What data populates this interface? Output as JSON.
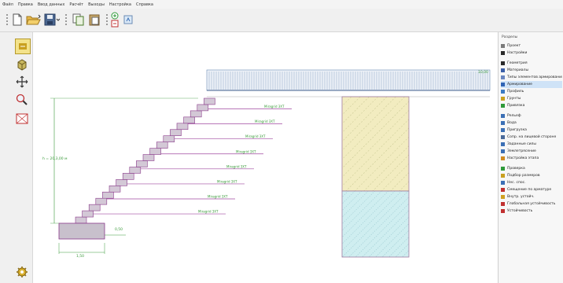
{
  "menu": [
    "Файл",
    "Правка",
    "Ввод данных",
    "Расчёт",
    "Выходы",
    "Настройка",
    "Справка"
  ],
  "panel": {
    "title": "Разделы",
    "items": [
      {
        "label": "Проект",
        "color": "#7a7a7a",
        "gap": false,
        "selected": false
      },
      {
        "label": "Настройки",
        "color": "#2a2a2a",
        "gap": false,
        "selected": false
      },
      {
        "label": "Геометрия",
        "color": "#2a2a2a",
        "gap": true,
        "selected": false
      },
      {
        "label": "Материалы",
        "color": "#3b5fa8",
        "gap": false,
        "selected": false
      },
      {
        "label": "Типы элементов армирования",
        "color": "#6a86c0",
        "gap": false,
        "selected": false
      },
      {
        "label": "Армирование",
        "color": "#2f64b5",
        "gap": false,
        "selected": true
      },
      {
        "label": "Профиль",
        "color": "#3b7bc4",
        "gap": false,
        "selected": false
      },
      {
        "label": "Грунты",
        "color": "#c9a020",
        "gap": false,
        "selected": false
      },
      {
        "label": "Привязка",
        "color": "#2f9a3a",
        "gap": false,
        "selected": false
      },
      {
        "label": "Рельеф",
        "color": "#3b6fb5",
        "gap": true,
        "selected": false
      },
      {
        "label": "Вода",
        "color": "#3b6fb5",
        "gap": false,
        "selected": false
      },
      {
        "label": "Пригрузка",
        "color": "#3b6fb5",
        "gap": false,
        "selected": false
      },
      {
        "label": "Сопр. на лицевой стороне",
        "color": "#4a6a9a",
        "gap": false,
        "selected": false
      },
      {
        "label": "Заданные силы",
        "color": "#3b6fb5",
        "gap": false,
        "selected": false
      },
      {
        "label": "Землетрясение",
        "color": "#3b6fb5",
        "gap": false,
        "selected": false
      },
      {
        "label": "Настройка этапа",
        "color": "#d08a20",
        "gap": false,
        "selected": false
      },
      {
        "label": "Проверка",
        "color": "#2f9a3a",
        "gap": true,
        "selected": false
      },
      {
        "label": "Подбор размеров",
        "color": "#c9a020",
        "gap": false,
        "selected": false
      },
      {
        "label": "Нес. спос.",
        "color": "#3b6fb5",
        "gap": false,
        "selected": false
      },
      {
        "label": "Смещение по арматуре",
        "color": "#c03030",
        "gap": false,
        "selected": false
      },
      {
        "label": "Внутр. устойч.",
        "color": "#d0a020",
        "gap": false,
        "selected": false
      },
      {
        "label": "Глобальная устойчивость",
        "color": "#c03030",
        "gap": false,
        "selected": false
      },
      {
        "label": "Устойчивость",
        "color": "#c03030",
        "gap": false,
        "selected": false
      }
    ]
  },
  "drawing": {
    "load_value": "10,00",
    "reinforcement_label": "Miragrid 3XT",
    "height_dim": "h = 20,3,00 м",
    "setback_dim": "0,50",
    "base_width_dim": "1,50",
    "block_count": 20,
    "reinforcement_layers": 8,
    "colors": {
      "wall": "#d3c8d6",
      "wall_edge": "#8a3a8a",
      "fill_soil": "#f2ecc0",
      "water_soil": "#cfeef0",
      "accent": "#3a9a3a"
    }
  }
}
